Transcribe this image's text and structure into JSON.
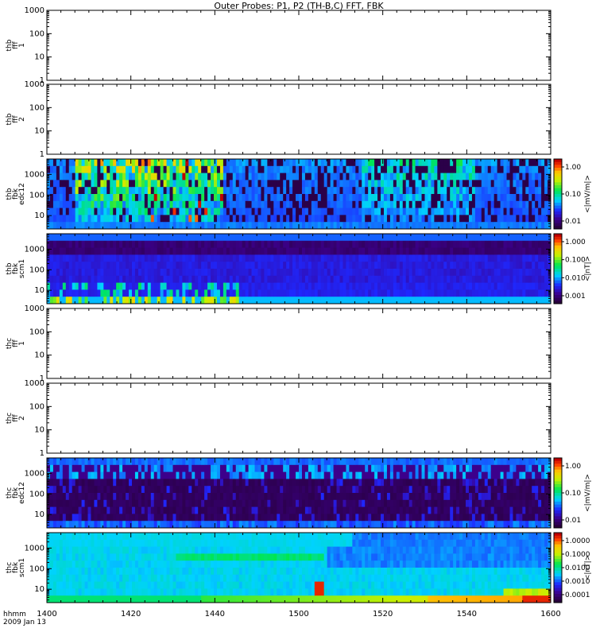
{
  "chart_data": {
    "type": "heatmap",
    "title": "Outer Probes: P1, P2 (TH-B,C) FFT, FBK",
    "x_axis": {
      "ticks": [
        "1400",
        "1420",
        "1440",
        "1500",
        "1520",
        "1540",
        "1600"
      ],
      "label_line1": "hhmm",
      "label_line2": "2009 Jan 13"
    },
    "panels": [
      {
        "id": "thb-fff1",
        "ylabel": [
          "thb",
          "fff",
          "1"
        ],
        "yticks": [
          "1",
          "10",
          "100",
          "1000"
        ],
        "kind": "empty"
      },
      {
        "id": "thb-fff2",
        "ylabel": [
          "thb",
          "fff",
          "2"
        ],
        "yticks": [
          "1",
          "10",
          "100",
          "1000"
        ],
        "kind": "empty"
      },
      {
        "id": "thb-fbk-edc12",
        "ylabel": [
          "thb",
          "fbk",
          "edc12"
        ],
        "yticks": [
          "10",
          "100",
          "1000"
        ],
        "kind": "spectrogram",
        "colorbar": {
          "label": "<|mV/m|>",
          "ticks": [
            "1.00",
            "0.10",
            "0.01"
          ]
        }
      },
      {
        "id": "thb-fbk-scm1",
        "ylabel": [
          "thb",
          "fbk",
          "scm1"
        ],
        "yticks": [
          "10",
          "100",
          "1000"
        ],
        "kind": "spectrogram",
        "colorbar": {
          "label": "<|nT|>",
          "ticks": [
            "1.000",
            "0.100",
            "0.010",
            "0.001"
          ]
        }
      },
      {
        "id": "thc-fff1",
        "ylabel": [
          "thc",
          "fff",
          "1"
        ],
        "yticks": [
          "1",
          "10",
          "100",
          "1000"
        ],
        "kind": "empty"
      },
      {
        "id": "thc-fff2",
        "ylabel": [
          "thc",
          "fff",
          "2"
        ],
        "yticks": [
          "1",
          "10",
          "100",
          "1000"
        ],
        "kind": "empty"
      },
      {
        "id": "thc-fbk-edc12",
        "ylabel": [
          "thc",
          "fbk",
          "edc12"
        ],
        "yticks": [
          "10",
          "100",
          "1000"
        ],
        "kind": "spectrogram",
        "colorbar": {
          "label": "<|mV/m|>",
          "ticks": [
            "1.00",
            "0.10",
            "0.01"
          ]
        }
      },
      {
        "id": "thc-fbk-scm1",
        "ylabel": [
          "thc",
          "fbk",
          "scm1"
        ],
        "yticks": [
          "10",
          "100",
          "1000"
        ],
        "kind": "spectrogram",
        "colorbar": {
          "label": "<|nT|>",
          "ticks": [
            "1.0000",
            "0.1000",
            "0.0100",
            "0.0010",
            "0.0001"
          ]
        }
      }
    ]
  }
}
